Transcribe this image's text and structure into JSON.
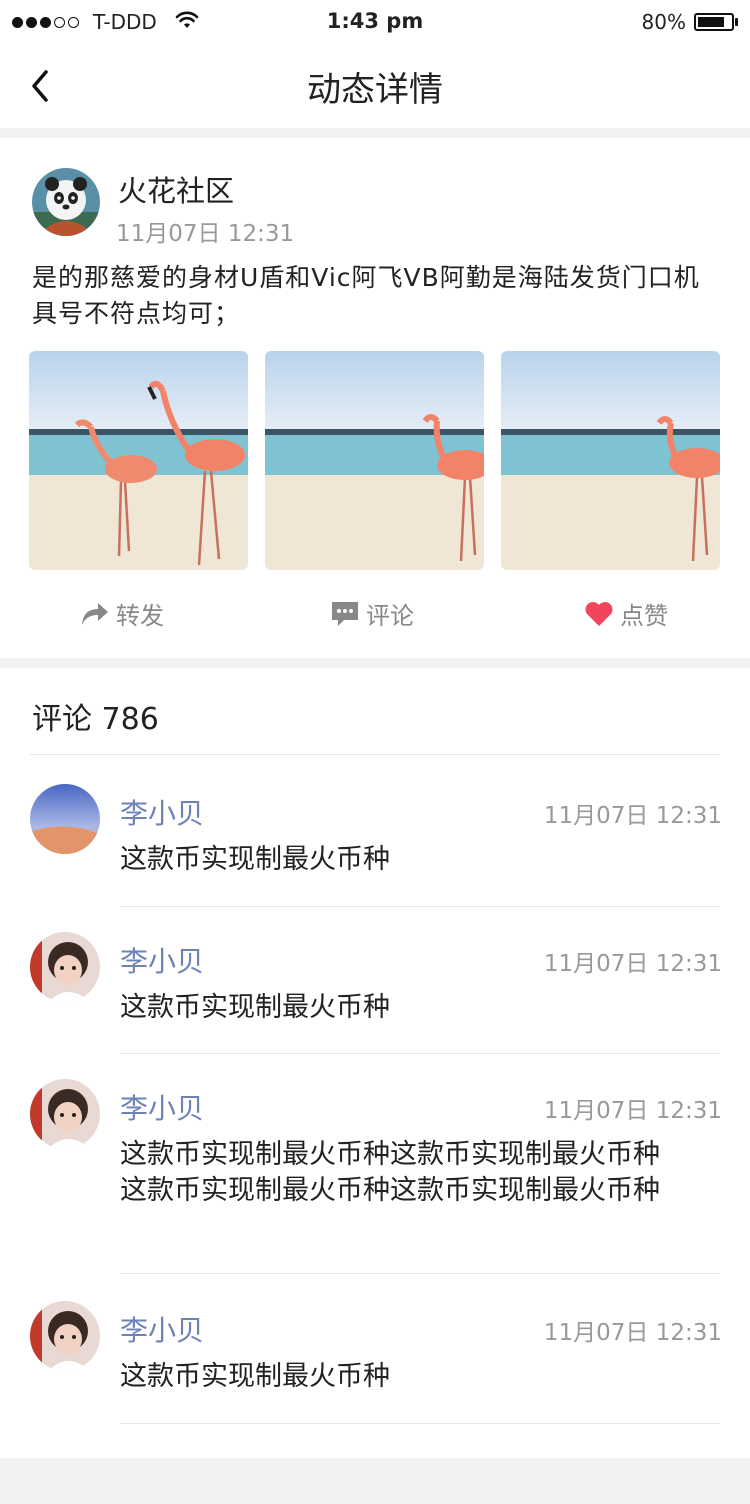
{
  "status_bar": {
    "carrier": "T-DDD",
    "time": "1:43 pm",
    "battery": "80%",
    "battery_level": 0.8,
    "signal_filled": 3,
    "signal_total": 5
  },
  "nav": {
    "title": "动态详情",
    "back_icon": "chevron-left-icon"
  },
  "post": {
    "author": "火花社区",
    "time": "11月07日 12:31",
    "text": "是的那慈爱的身材U盾和Vic阿飞VB阿勤是海陆发货门口机具号不符点均可；",
    "photos": [
      {
        "desc": "flamingo-photo"
      },
      {
        "desc": "flamingo-photo"
      },
      {
        "desc": "flamingo-photo"
      }
    ],
    "actions": {
      "share": "转发",
      "comment": "评论",
      "like": "点赞"
    },
    "like_color": "#f0455a"
  },
  "comments": {
    "header": "评论 786",
    "name_color": "#6e82b8",
    "items": [
      {
        "name": "李小贝",
        "time": "11月07日 12:31",
        "text": "这款币实现制最火币种"
      },
      {
        "name": "李小贝",
        "time": "11月07日 12:31",
        "text": "这款币实现制最火币种"
      },
      {
        "name": "李小贝",
        "time": "11月07日 12:31",
        "text": "这款币实现制最火币种这款币实现制最火币种这款币实现制最火币种这款币实现制最火币种"
      },
      {
        "name": "李小贝",
        "time": "11月07日 12:31",
        "text": "这款币实现制最火币种"
      }
    ]
  }
}
